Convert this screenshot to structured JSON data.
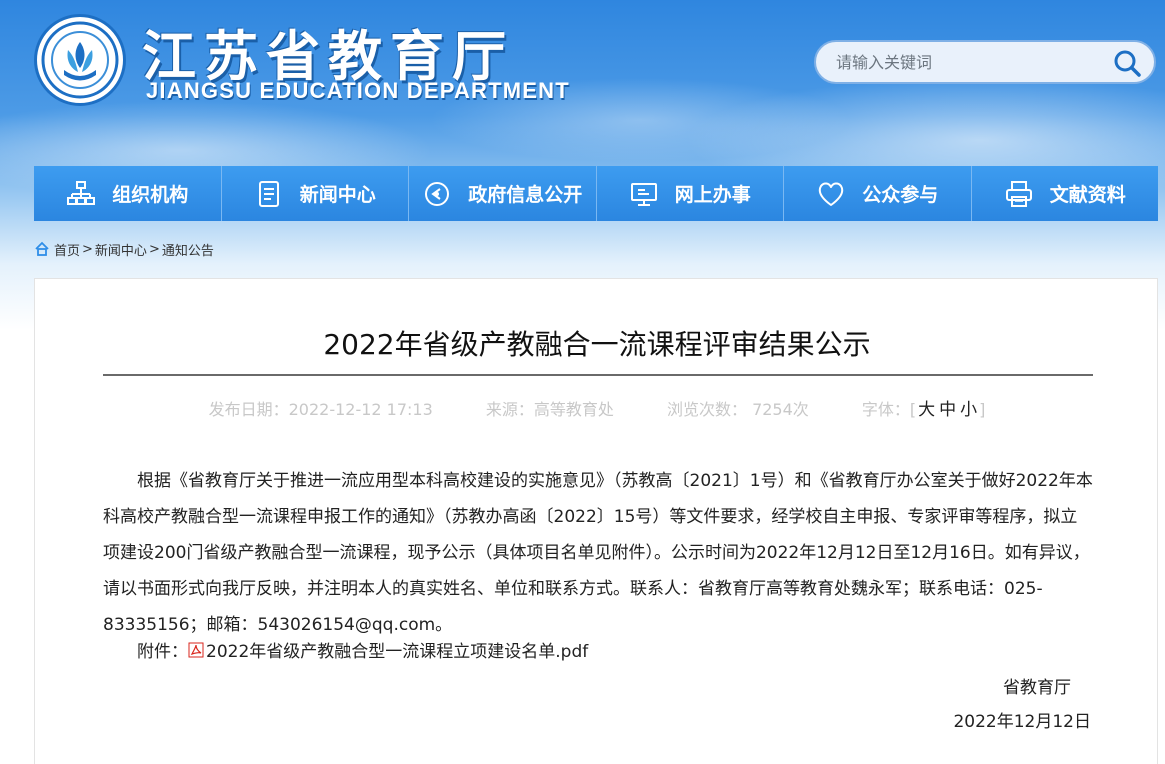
{
  "header": {
    "title": "江苏省教育厅",
    "subtitle": "JIANGSU EDUCATION DEPARTMENT",
    "search_placeholder": "请输入关键词"
  },
  "nav": [
    {
      "label": "组织机构",
      "icon": "org-chart-icon"
    },
    {
      "label": "新闻中心",
      "icon": "document-icon"
    },
    {
      "label": "政府信息公开",
      "icon": "play-circle-icon"
    },
    {
      "label": "网上办事",
      "icon": "monitor-icon"
    },
    {
      "label": "公众参与",
      "icon": "heart-icon"
    },
    {
      "label": "文献资料",
      "icon": "printer-icon"
    }
  ],
  "breadcrumb": {
    "home": "首页",
    "news": "新闻中心",
    "notice": "通知公告",
    "sep": ">"
  },
  "article": {
    "title": "2022年省级产教融合一流课程评审结果公示",
    "publish_date": "发布日期：2022-12-12 17:13",
    "source": "来源：高等教育处",
    "views": "浏览次数： 7254次",
    "font_label": "字体：",
    "font_large": "大",
    "font_medium": "中",
    "font_small": "小",
    "body": "根据《省教育厅关于推进一流应用型本科高校建设的实施意见》（苏教高〔2021〕1号）和《省教育厅办公室关于做好2022年本科高校产教融合型一流课程申报工作的通知》（苏教办高函〔2022〕15号）等文件要求，经学校自主申报、专家评审等程序，拟立项建设200门省级产教融合型一流课程，现予公示（具体项目名单见附件）。公示时间为2022年12月12日至12月16日。如有异议，请以书面形式向我厅反映，并注明本人的真实姓名、单位和联系方式。联系人：省教育厅高等教育处魏永军；联系电话：025-83335156；邮箱：543026154@qq.com。",
    "attachment_label": "附件：",
    "attachment_name": "2022年省级产教融合型一流课程立项建设名单.pdf",
    "sign_org": "省教育厅",
    "sign_date": "2022年12月12日"
  },
  "colors": {
    "nav_blue": "#2f8ee8",
    "header_blue": "#2f86df",
    "pdf_red": "#d9261c"
  }
}
